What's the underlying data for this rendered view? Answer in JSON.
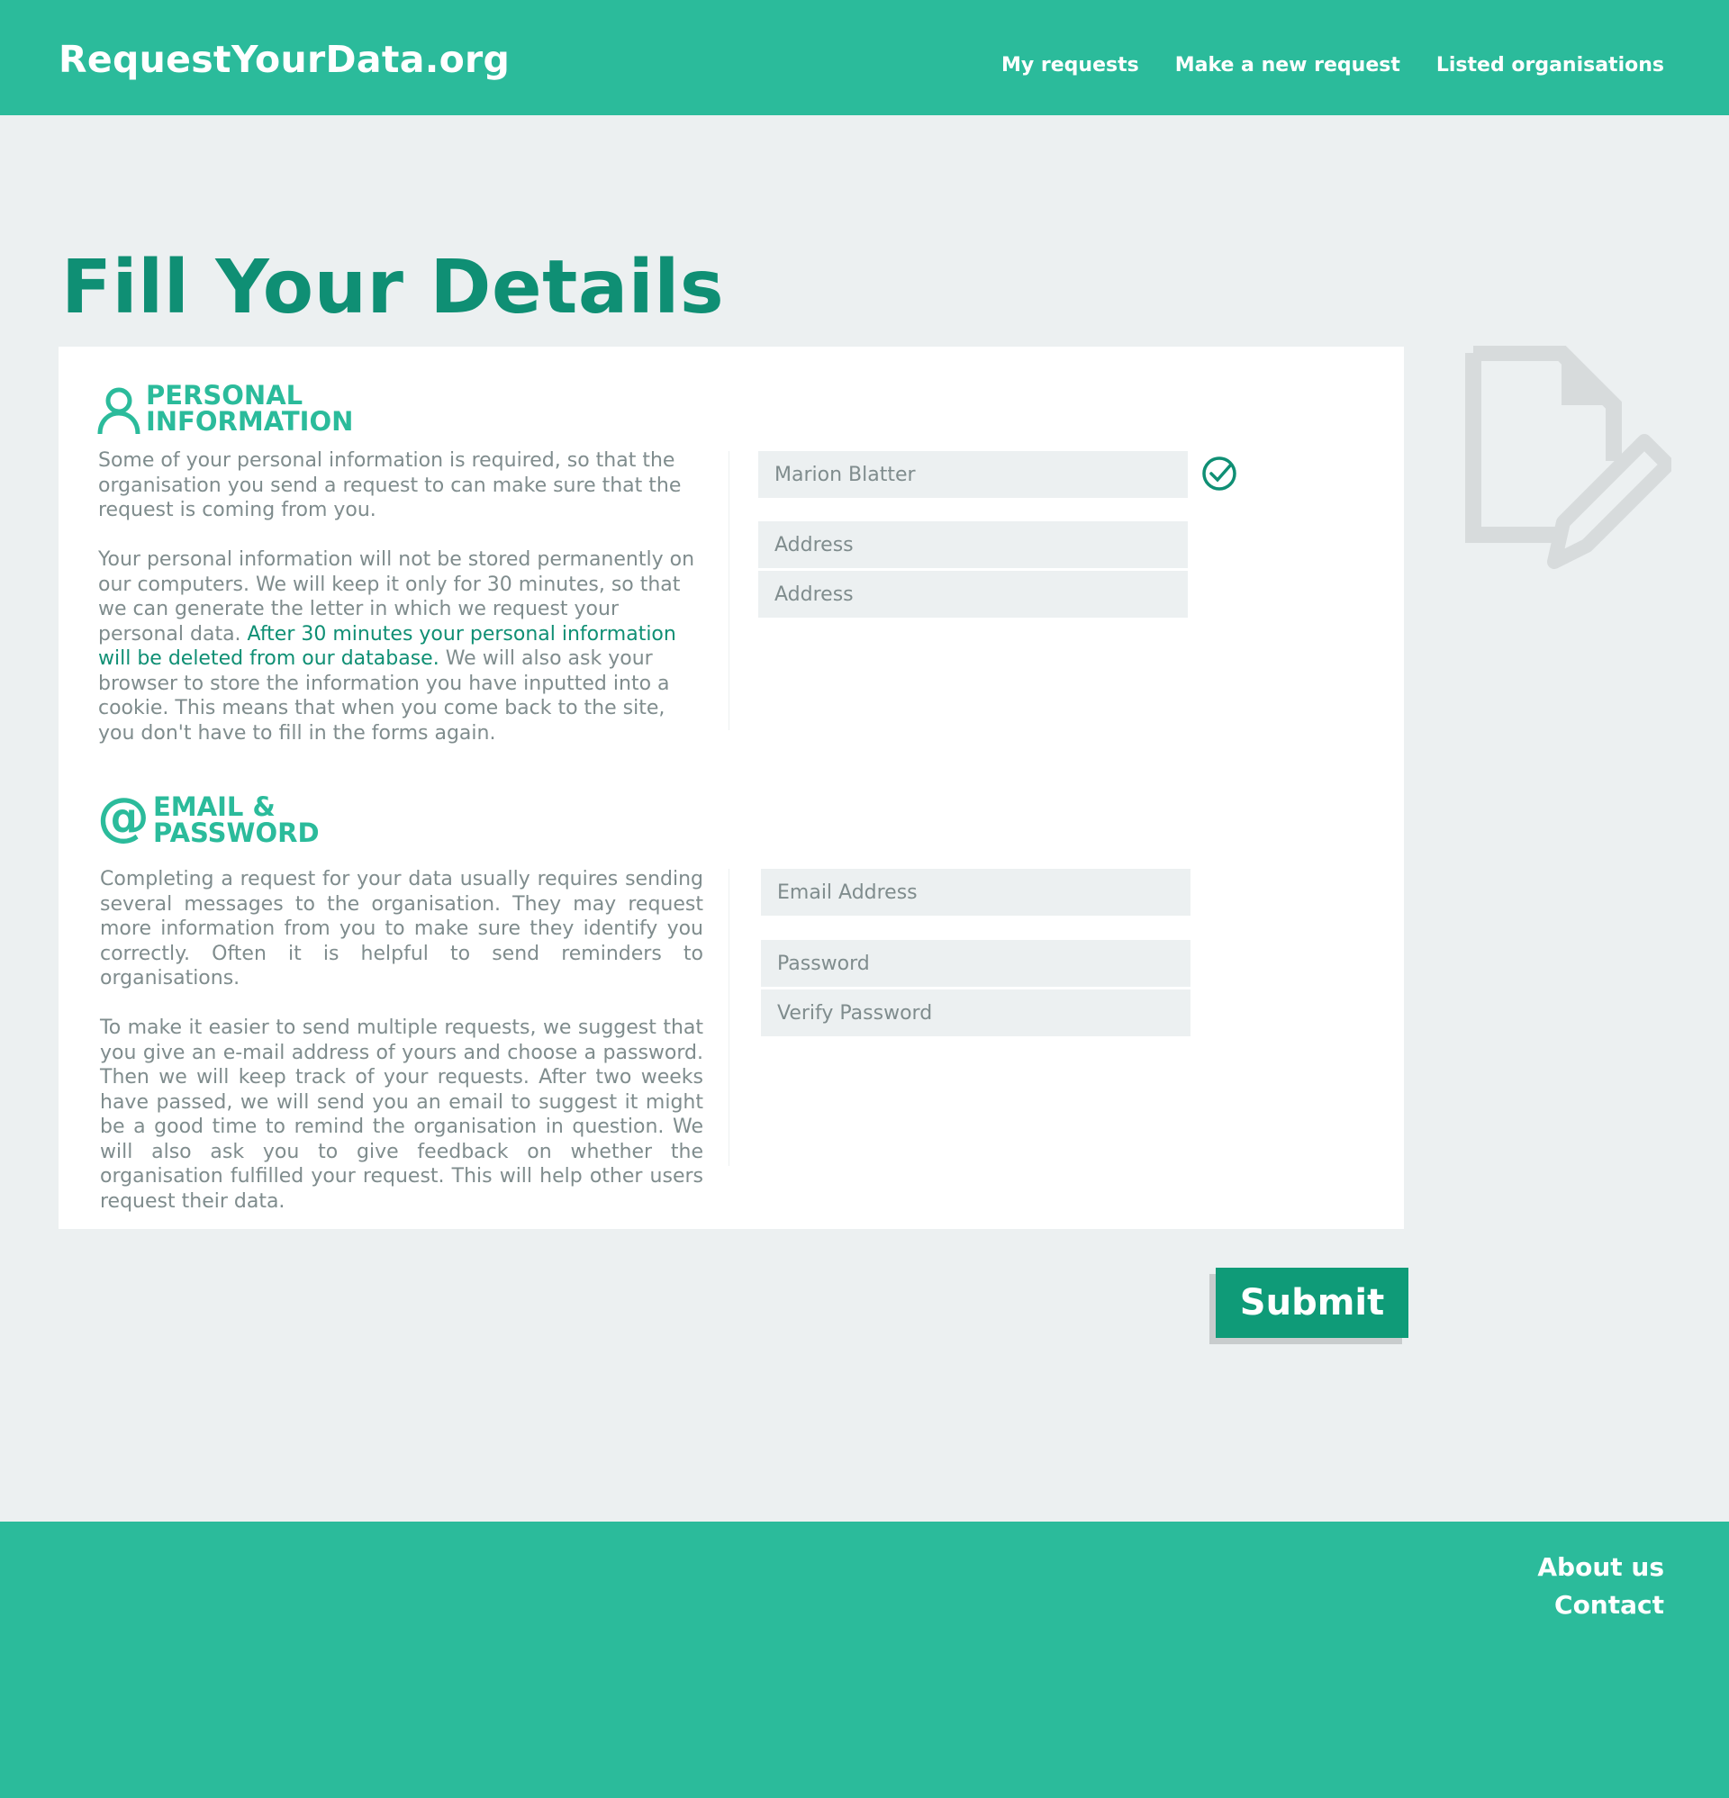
{
  "header": {
    "logo": "RequestYourData.org",
    "nav": [
      "My requests",
      "Make a new request",
      "Listed organisations"
    ]
  },
  "page": {
    "title": "Fill Your Details"
  },
  "personal": {
    "heading_line1": "PERSONAL",
    "heading_line2": "INFORMATION",
    "icon": "user-icon",
    "para1": "Some of your personal information is required, so that the organisation you send a request to can make sure that the request is coming from you.",
    "para2_start": "Your personal information will not be stored permanently on our computers. We will keep it only  for 30 minutes, so that we can generate the letter in which we request your personal data. ",
    "para2_highlight": "After 30 minutes your personal information will be deleted from our database.",
    "para2_end": " We will also ask your browser to store the information you have inputted into a cookie. This means that when you come back to the site, you don't have to fill in the forms again.",
    "name_value": "Marion Blatter",
    "address1_placeholder": "Address",
    "address2_placeholder": "Address"
  },
  "account": {
    "heading_line1": "EMAIL &",
    "heading_line2": "PASSWORD",
    "icon_glyph": "@",
    "para1": "Completing a request for your data usually requires sending several messages to the organisation. They may request more information from you to make sure they identify you correctly. Often it is helpful to send reminders to organisations.",
    "para2": "To make it easier to send multiple requests, we suggest that you give an e-mail address of yours and choose a password. Then we will keep track of your requests. After two weeks have passed, we will send you an email to suggest it might be a good time to remind the organisation in question. We will also ask you to give feedback on whether the organisation fulfilled your request. This will help other users request their data.",
    "email_placeholder": "Email Address",
    "password_placeholder": "Password",
    "verify_placeholder": "Verify Password"
  },
  "submit_label": "Submit",
  "footer": {
    "links": [
      "About us",
      "Contact"
    ]
  },
  "colors": {
    "brand": "#2bbb9b",
    "brand_dark": "#0f8f74",
    "button": "#0f9b78",
    "text_muted": "#7f8c8d",
    "background": "#ecf0f1"
  }
}
